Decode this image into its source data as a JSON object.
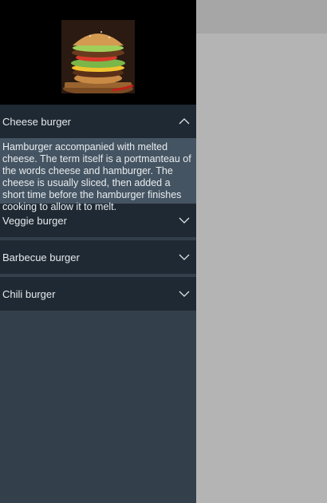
{
  "header": {
    "image_alt": "Burger photo"
  },
  "accordion": {
    "items": [
      {
        "label": "Cheese burger",
        "expanded": true,
        "icon": "chevron-up-icon",
        "description": "Hamburger accompanied with melted cheese. The term itself is a portmanteau of the words cheese and hamburger. The cheese is usually sliced, then added a short time before the hamburger finishes cooking to allow it to melt."
      },
      {
        "label": "Veggie burger",
        "expanded": false,
        "icon": "chevron-down-icon"
      },
      {
        "label": "Barbecue burger",
        "expanded": false,
        "icon": "chevron-down-icon"
      },
      {
        "label": "Chili burger",
        "expanded": false,
        "icon": "chevron-down-icon"
      }
    ]
  },
  "colors": {
    "drawer_bg": "#333f4a",
    "item_header_bg": "#1f2933",
    "expanded_body_bg": "#455462",
    "main_bg": "#b4b4b4",
    "main_topbar_bg": "#a6a6a6",
    "text": "#e6e9ec"
  }
}
